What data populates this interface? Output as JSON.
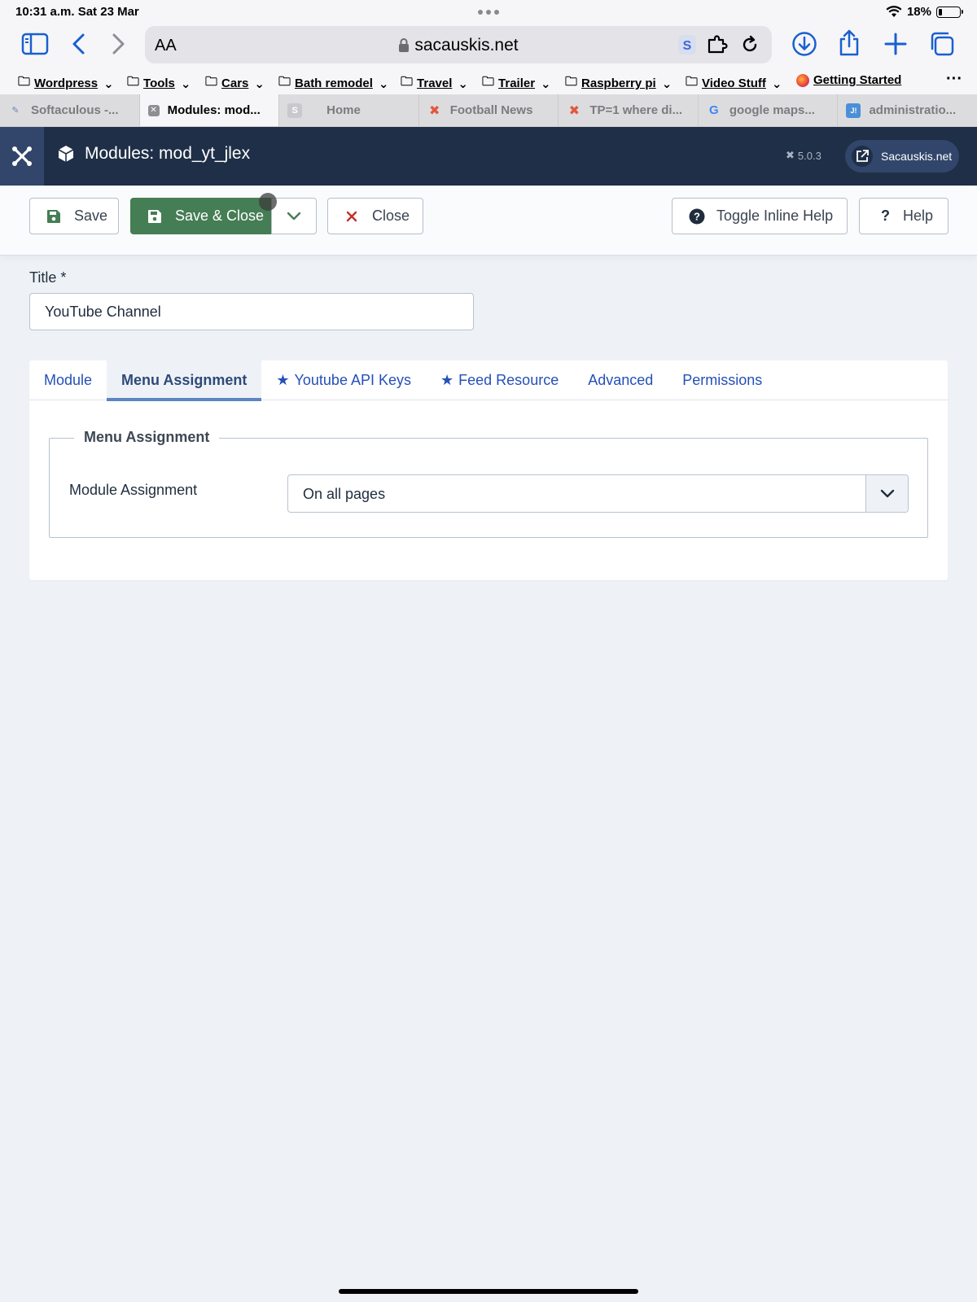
{
  "status_bar": {
    "time": "10:31 a.m.   Sat 23 Mar",
    "battery": "18%",
    "battery_level": 0.18
  },
  "address_bar": {
    "text_size_label": "AA",
    "domain": "sacauskis.net"
  },
  "bookmarks": [
    {
      "label": "Wordpress"
    },
    {
      "label": "Tools"
    },
    {
      "label": "Cars"
    },
    {
      "label": "Bath remodel"
    },
    {
      "label": "Travel"
    },
    {
      "label": "Trailer"
    },
    {
      "label": "Raspberry pi"
    },
    {
      "label": "Video Stuff"
    },
    {
      "label": "Getting Started"
    }
  ],
  "tabs": [
    {
      "label": "Softaculous -..."
    },
    {
      "label": "Modules: mod..."
    },
    {
      "label": "Home"
    },
    {
      "label": "Football News"
    },
    {
      "label": "TP=1 where di..."
    },
    {
      "label": "google maps..."
    },
    {
      "label": "administratio..."
    }
  ],
  "header": {
    "title": "Modules: mod_yt_jlex",
    "version": "5.0.3",
    "site_button": "Sacauskis.net"
  },
  "toolbar": {
    "save": "Save",
    "save_close": "Save & Close",
    "close": "Close",
    "toggle_inline_help": "Toggle Inline Help",
    "help": "Help"
  },
  "form": {
    "title_label": "Title *",
    "title_value": "YouTube Channel",
    "tabs": [
      {
        "label": "Module"
      },
      {
        "label": "Menu Assignment"
      },
      {
        "label": "Youtube API Keys"
      },
      {
        "label": "Feed Resource"
      },
      {
        "label": "Advanced"
      },
      {
        "label": "Permissions"
      }
    ],
    "fieldset_legend": "Menu Assignment",
    "module_assignment_label": "Module Assignment",
    "module_assignment_value": "On all pages"
  },
  "colors": {
    "joomla_header": "#1f2f47",
    "save_close_green": "#457d54",
    "link_blue": "#2450b8",
    "page_bg": "#eef2f6"
  }
}
